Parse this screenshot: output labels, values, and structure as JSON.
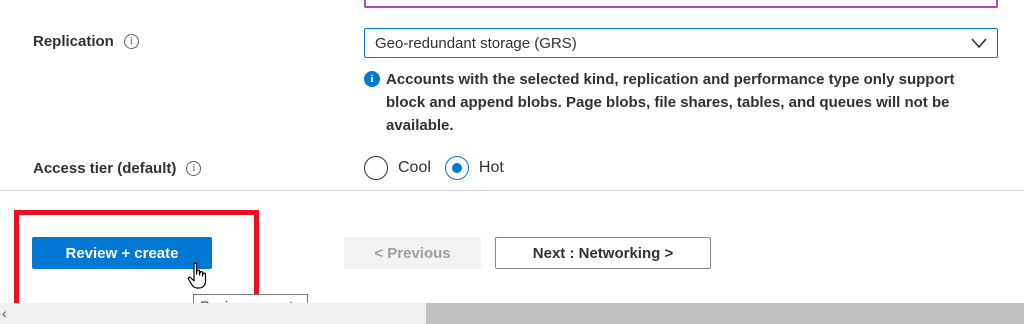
{
  "replication": {
    "label": "Replication",
    "selected_value": "Geo-redundant storage (GRS)",
    "note": "Accounts with the selected kind, replication and performance type only support block and append blobs. Page blobs, file shares, tables, and queues will not be available."
  },
  "access_tier": {
    "label": "Access tier (default)",
    "options": [
      {
        "label": "Cool",
        "checked": false
      },
      {
        "label": "Hot",
        "checked": true
      }
    ]
  },
  "footer": {
    "review_create_label": "Review + create",
    "previous_label": "< Previous",
    "next_label": "Next : Networking >",
    "tooltip": "Review + create"
  },
  "scrollbar": {
    "left_arrow": "‹"
  },
  "colors": {
    "accent": "#0078d4",
    "highlight": "#e81123",
    "focus_border": "#b146c2"
  }
}
